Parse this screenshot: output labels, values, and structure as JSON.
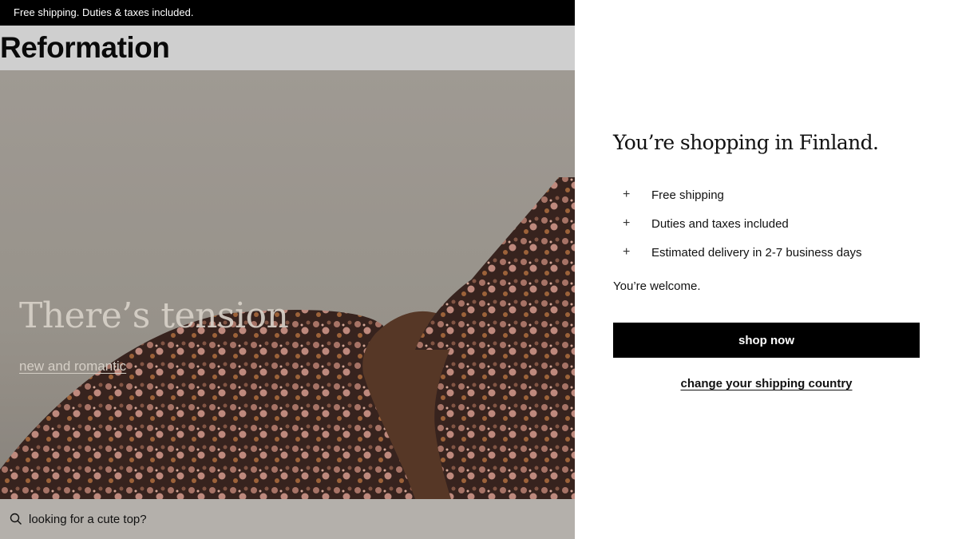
{
  "promo_bar": {
    "text": "Free shipping. Duties & taxes included."
  },
  "header": {
    "logo": "Reformation"
  },
  "hero": {
    "headline": "There’s tension",
    "link": "new and romantic"
  },
  "search": {
    "text": "looking for a cute top?",
    "icon": "search-icon"
  },
  "modal": {
    "title": "You’re shopping in Finland.",
    "benefits": [
      {
        "icon": "+",
        "label": "Free shipping"
      },
      {
        "icon": "+",
        "label": "Duties and taxes included"
      },
      {
        "icon": "+",
        "label": "Estimated delivery in 2-7 business days"
      }
    ],
    "welcome": "You’re welcome.",
    "primary_button": "shop now",
    "secondary_link": "change your shipping country"
  },
  "colors": {
    "promo_bg": "#000000",
    "header_bg": "#cfcfcf",
    "button_bg": "#000000",
    "panel_bg": "#ffffff"
  }
}
